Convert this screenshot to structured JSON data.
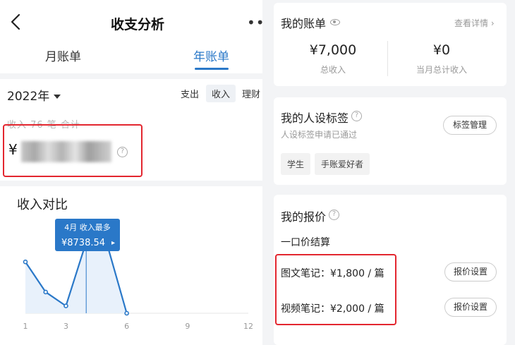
{
  "left": {
    "title": "收支分析",
    "more": "••",
    "tabs": [
      "月账单",
      "年账单"
    ],
    "year": "2022年",
    "filters": [
      "支出",
      "收入",
      "理财"
    ],
    "summary_label": "收入 76 笔 合计",
    "currency": "¥",
    "chart": {
      "title": "收入对比",
      "tooltip_title": "4月 收入最多",
      "tooltip_value": "¥8738.54",
      "tooltip_arrow": "▸"
    }
  },
  "chart_data": {
    "type": "area",
    "x": [
      1,
      2,
      3,
      4,
      5,
      6
    ],
    "values": [
      6300,
      2600,
      900,
      8738.54,
      8738.54,
      0
    ],
    "x_ticks": [
      "1",
      "3",
      "6",
      "9",
      "12"
    ],
    "highlight": {
      "x": 4,
      "label": "4月 收入最多",
      "value": "¥8738.54"
    },
    "color": "#2a78c8",
    "fill": "#e8f1fb"
  },
  "right": {
    "account": {
      "title": "我的账单",
      "link": "查看详情",
      "chevron": "›",
      "stats": [
        {
          "value": "¥7,000",
          "label": "总收入"
        },
        {
          "value": "¥0",
          "label": "当月总计收入"
        }
      ]
    },
    "persona": {
      "title": "我的人设标签",
      "note": "人设标签申请已通过",
      "manage": "标签管理",
      "tags": [
        "学生",
        "手账爱好者"
      ]
    },
    "quote": {
      "title": "我的报价",
      "subtitle": "一口价结算",
      "items": [
        {
          "label": "图文笔记：¥1,800 / 篇",
          "button": "报价设置"
        },
        {
          "label": "视频笔记：¥2,000 / 篇",
          "button": "报价设置"
        }
      ]
    }
  },
  "colors": {
    "accent": "#2a78c8",
    "highlight": "#e3262f",
    "muted": "#999999"
  }
}
